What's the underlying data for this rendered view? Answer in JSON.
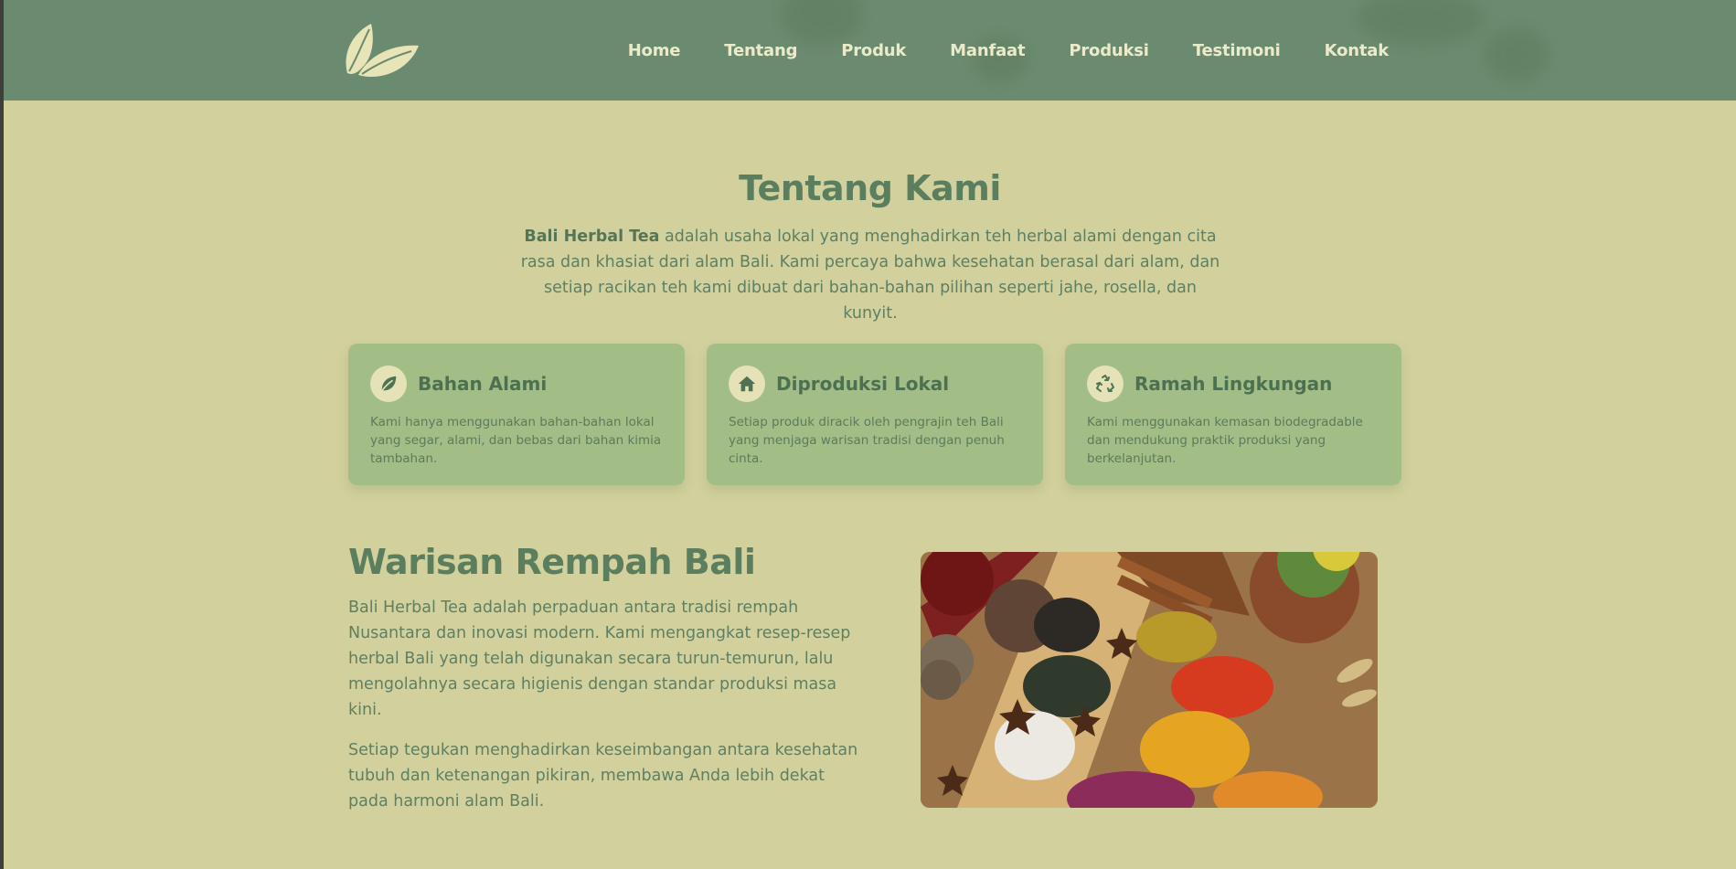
{
  "nav": {
    "items": [
      "Home",
      "Tentang",
      "Produk",
      "Manfaat",
      "Produksi",
      "Testimoni",
      "Kontak"
    ]
  },
  "about": {
    "title": "Tentang Kami",
    "brand": "Bali Herbal Tea",
    "text": " adalah usaha lokal yang menghadirkan teh herbal alami dengan cita rasa dan khasiat dari alam Bali. Kami percaya bahwa kesehatan berasal dari alam, dan setiap racikan teh kami dibuat dari bahan-bahan pilihan seperti jahe, rosella, dan kunyit."
  },
  "cards": [
    {
      "icon": "leaf-icon",
      "title": "Bahan Alami",
      "text": "Kami hanya menggunakan bahan-bahan lokal yang segar, alami, dan bebas dari bahan kimia tambahan."
    },
    {
      "icon": "home-icon",
      "title": "Diproduksi Lokal",
      "text": "Setiap produk diracik oleh pengrajin teh Bali yang menjaga warisan tradisi dengan penuh cinta."
    },
    {
      "icon": "recycle-icon",
      "title": "Ramah Lingkungan",
      "text": "Kami menggunakan kemasan biodegradable dan mendukung praktik produksi yang berkelanjutan."
    }
  ],
  "heritage": {
    "title": "Warisan Rempah Bali",
    "p1": "Bali Herbal Tea adalah perpaduan antara tradisi rempah Nusantara dan inovasi modern. Kami mengangkat resep-resep herbal Bali yang telah digunakan secara turun-temurun, lalu mengolahnya secara higienis dengan standar produksi masa kini.",
    "p2": "Setiap tegukan menghadirkan keseimbangan antara kesehatan tubuh dan ketenangan pikiran, membawa Anda lebih dekat pada harmoni alam Bali."
  },
  "colors": {
    "header": "#6b8b70",
    "page_bg": "#d2d19e",
    "card_bg": "#a2bd86",
    "heading": "#5b7f5e",
    "nav_text": "#ecebc9"
  }
}
